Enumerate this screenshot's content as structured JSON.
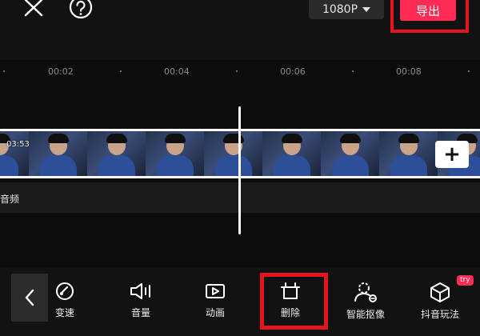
{
  "top_bar": {
    "resolution_label": "1080P",
    "export_label": "导出"
  },
  "timeline": {
    "ruler_labels": [
      "00:02",
      "00:04",
      "00:06",
      "00:08"
    ],
    "clip_duration": "03:53",
    "audio_label": "音频",
    "add_clip_label": "+"
  },
  "toolbar": {
    "items": [
      {
        "label": "变速",
        "icon": "speed-icon"
      },
      {
        "label": "音量",
        "icon": "volume-icon"
      },
      {
        "label": "动画",
        "icon": "animation-icon"
      },
      {
        "label": "删除",
        "icon": "delete-icon"
      },
      {
        "label": "智能抠像",
        "icon": "smart-cutout-icon"
      },
      {
        "label": "抖音玩法",
        "icon": "douyin-effects-icon"
      }
    ],
    "badge": "try"
  },
  "colors": {
    "accent": "#fe2c55",
    "highlight_box": "#e6141b",
    "background": "#121212"
  }
}
